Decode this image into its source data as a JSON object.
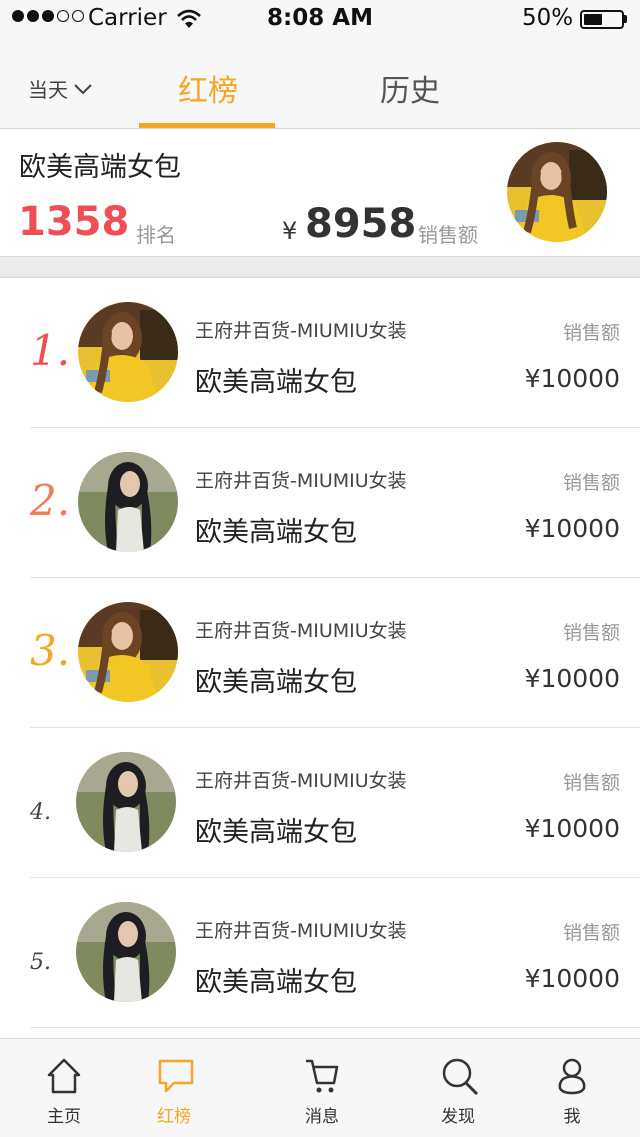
{
  "status_bar": {
    "carrier": "Carrier",
    "time": "8:08 AM",
    "battery": "50%",
    "battery_level": 0.5,
    "signal_bars": 3
  },
  "tabs": {
    "date_filter": "当天",
    "items": [
      "红榜",
      "历史"
    ],
    "active": 0
  },
  "summary": {
    "title": "欧美高端女包",
    "rank": "1358",
    "rank_label": "排名",
    "currency": "¥",
    "amount": "8958",
    "amount_label": "销售额"
  },
  "list": [
    {
      "rank": "1.",
      "store": "王府井百货-MIUMIU女装",
      "name": "欧美高端女包",
      "label": "销售额",
      "price": "¥10000",
      "rank_color": "#f04e55",
      "avatar": "yellow"
    },
    {
      "rank": "2.",
      "store": "王府井百货-MIUMIU女装",
      "name": "欧美高端女包",
      "label": "销售额",
      "price": "¥10000",
      "rank_color": "#f27a55",
      "avatar": "dark"
    },
    {
      "rank": "3.",
      "store": "王府井百货-MIUMIU女装",
      "name": "欧美高端女包",
      "label": "销售额",
      "price": "¥10000",
      "rank_color": "#f5a623",
      "avatar": "yellow"
    },
    {
      "rank": "4.",
      "store": "王府井百货-MIUMIU女装",
      "name": "欧美高端女包",
      "label": "销售额",
      "price": "¥10000",
      "rank_color": "#444444",
      "avatar": "dark"
    },
    {
      "rank": "5.",
      "store": "王府井百货-MIUMIU女装",
      "name": "欧美高端女包",
      "label": "销售额",
      "price": "¥10000",
      "rank_color": "#444444",
      "avatar": "dark"
    }
  ],
  "tabbar": {
    "items": [
      {
        "label": "主页",
        "icon": "home-icon"
      },
      {
        "label": "红榜",
        "icon": "chat-bubble-icon"
      },
      {
        "label": "消息",
        "icon": "cart-icon"
      },
      {
        "label": "发现",
        "icon": "search-icon"
      },
      {
        "label": "我",
        "icon": "user-icon"
      }
    ],
    "active": 1
  },
  "colors": {
    "accent": "#f5a623",
    "rank_red": "#f04e55",
    "muted": "#999999"
  }
}
